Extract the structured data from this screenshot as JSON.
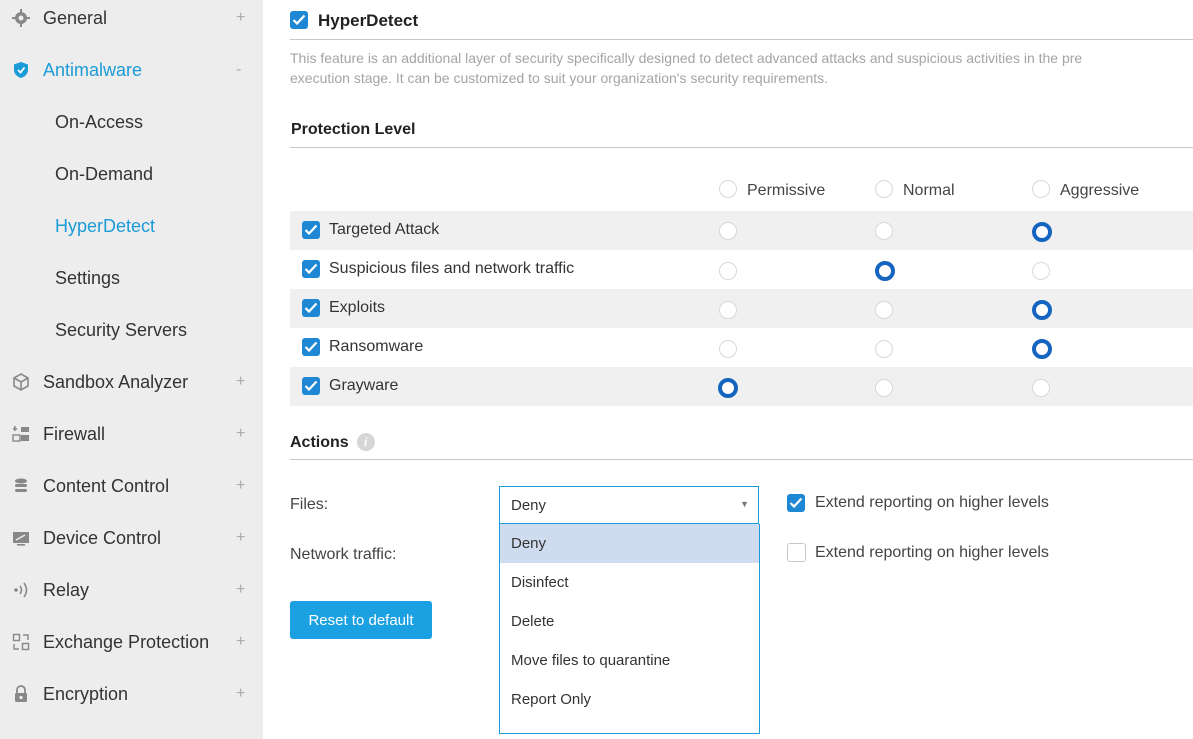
{
  "sidebar": {
    "items": [
      {
        "label": "General",
        "toggle": "+",
        "icon": "gear-icon"
      },
      {
        "label": "Antimalware",
        "toggle": "-",
        "icon": "shield-icon"
      },
      {
        "label": "On-Access"
      },
      {
        "label": "On-Demand"
      },
      {
        "label": "HyperDetect"
      },
      {
        "label": "Settings"
      },
      {
        "label": "Security Servers"
      },
      {
        "label": "Sandbox Analyzer",
        "toggle": "+",
        "icon": "cube-icon"
      },
      {
        "label": "Firewall",
        "toggle": "+",
        "icon": "firewall-icon"
      },
      {
        "label": "Content Control",
        "toggle": "+",
        "icon": "database-icon"
      },
      {
        "label": "Device Control",
        "toggle": "+",
        "icon": "monitor-icon"
      },
      {
        "label": "Relay",
        "toggle": "+",
        "icon": "relay-icon"
      },
      {
        "label": "Exchange Protection",
        "toggle": "+",
        "icon": "exchange-icon"
      },
      {
        "label": "Encryption",
        "toggle": "+",
        "icon": "lock-icon"
      }
    ],
    "active_color": "#1b9bd7"
  },
  "hyperdetect": {
    "title": "HyperDetect",
    "enabled": true,
    "description_line1": "This feature is an additional layer of security specifically designed to detect advanced attacks and suspicious activities in the pre",
    "description_line2": "execution stage. It can be customized to suit your organization's security requirements."
  },
  "protection": {
    "heading": "Protection Level",
    "columns": [
      "Permissive",
      "Normal",
      "Aggressive"
    ],
    "rows": [
      {
        "label": "Targeted Attack",
        "checked": true,
        "level": "Aggressive"
      },
      {
        "label": "Suspicious files and network traffic",
        "checked": true,
        "level": "Normal"
      },
      {
        "label": "Exploits",
        "checked": true,
        "level": "Aggressive"
      },
      {
        "label": "Ransomware",
        "checked": true,
        "level": "Aggressive"
      },
      {
        "label": "Grayware",
        "checked": true,
        "level": "Permissive"
      }
    ]
  },
  "actions": {
    "heading": "Actions",
    "info_icon": "i",
    "files_label": "Files:",
    "network_label": "Network traffic:",
    "files_value": "Deny",
    "dropdown_options": [
      "Deny",
      "Disinfect",
      "Delete",
      "Move files to quarantine",
      "Report Only"
    ],
    "selected_option": "Deny",
    "extend_files": {
      "label": "Extend reporting on higher levels",
      "checked": true
    },
    "extend_network": {
      "label": "Extend reporting on higher levels",
      "checked": false
    }
  },
  "reset_button": "Reset to default",
  "colors": {
    "accent": "#1b9bd7",
    "checkbox": "#1e88d4",
    "radio_selected": "#1565c0",
    "button": "#1ba1e2"
  }
}
